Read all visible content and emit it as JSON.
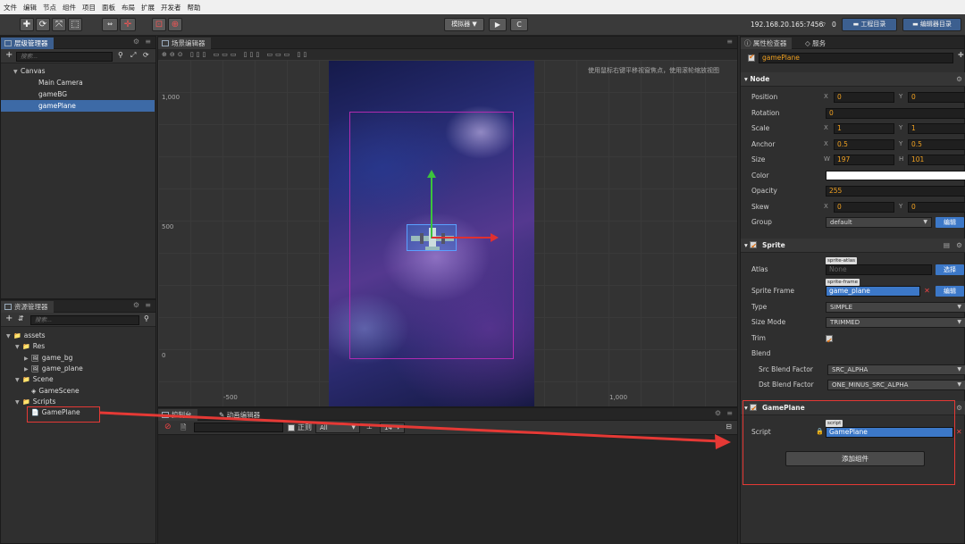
{
  "menu": [
    "文件",
    "编辑",
    "节点",
    "组件",
    "项目",
    "面板",
    "布局",
    "扩展",
    "开发者",
    "帮助"
  ],
  "toolbar": {
    "preview_mode": "模拟器 ▼",
    "play": "▶",
    "refresh": "C",
    "ip": "192.168.20.165:7456",
    "wifi_count": "0",
    "project_dir": "工程目录",
    "editor_dir": "编辑器目录"
  },
  "hierarchy": {
    "tab": "层级管理器",
    "search_placeholder": "搜索...",
    "nodes": [
      {
        "label": "Canvas",
        "depth": 0,
        "caret": "▼"
      },
      {
        "label": "Main Camera",
        "depth": 1,
        "caret": ""
      },
      {
        "label": "gameBG",
        "depth": 1,
        "caret": ""
      },
      {
        "label": "gamePlane",
        "depth": 1,
        "caret": "",
        "selected": true
      }
    ]
  },
  "assets": {
    "tab": "资源管理器",
    "search_placeholder": "搜索...",
    "items": [
      {
        "label": "assets",
        "depth": 0,
        "caret": "▼"
      },
      {
        "label": "Res",
        "depth": 1,
        "caret": "▼"
      },
      {
        "label": "game_bg",
        "depth": 2,
        "caret": "▶"
      },
      {
        "label": "game_plane",
        "depth": 2,
        "caret": "▶"
      },
      {
        "label": "Scene",
        "depth": 1,
        "caret": "▼"
      },
      {
        "label": "GameScene",
        "depth": 2,
        "caret": ""
      },
      {
        "label": "Scripts",
        "depth": 1,
        "caret": "▼"
      },
      {
        "label": "GamePlane",
        "depth": 2,
        "caret": ""
      }
    ]
  },
  "scene": {
    "tab": "场景编辑器",
    "hint": "使用鼠标右键平移视窗焦点，使用滚轮缩放视图",
    "ruler_y": [
      "1,000",
      "500",
      "0"
    ],
    "ruler_x": [
      "-500",
      "1,000"
    ]
  },
  "console": {
    "tab_console": "控制台",
    "tab_animation": "动画编辑器",
    "regex": "正则",
    "filter": "All",
    "font_size": "14"
  },
  "inspector": {
    "tab": "属性检查器",
    "tab2": "服务",
    "node_name": "gamePlane",
    "node_section": "Node",
    "position": {
      "label": "Position",
      "x": "0",
      "y": "0"
    },
    "rotation": {
      "label": "Rotation",
      "value": "0"
    },
    "scale": {
      "label": "Scale",
      "x": "1",
      "y": "1"
    },
    "anchor": {
      "label": "Anchor",
      "x": "0.5",
      "y": "0.5"
    },
    "size": {
      "label": "Size",
      "w": "197",
      "h": "101"
    },
    "color": {
      "label": "Color",
      "value": "#ffffff"
    },
    "opacity": {
      "label": "Opacity",
      "value": "255"
    },
    "skew": {
      "label": "Skew",
      "x": "0",
      "y": "0"
    },
    "group": {
      "label": "Group",
      "value": "default",
      "btn": "编辑"
    },
    "sprite_section": "Sprite",
    "atlas": {
      "label": "Atlas",
      "chip": "sprite-atlas",
      "value": "None",
      "btn": "选择"
    },
    "sprite_frame": {
      "label": "Sprite Frame",
      "chip": "sprite-frame",
      "value": "game_plane",
      "btn": "编辑"
    },
    "type": {
      "label": "Type",
      "value": "SIMPLE"
    },
    "size_mode": {
      "label": "Size Mode",
      "value": "TRIMMED"
    },
    "trim": {
      "label": "Trim"
    },
    "blend": {
      "label": "Blend"
    },
    "src_blend": {
      "label": "Src Blend Factor",
      "value": "SRC_ALPHA"
    },
    "dst_blend": {
      "label": "Dst Blend Factor",
      "value": "ONE_MINUS_SRC_ALPHA"
    },
    "gameplane_section": "GamePlane",
    "script": {
      "label": "Script",
      "chip": "script",
      "value": "GamePlane"
    },
    "add_component": "添加组件"
  },
  "colors": {
    "accent": "#3c78c8",
    "annotation": "#e53935",
    "field_text": "#f0a020"
  }
}
